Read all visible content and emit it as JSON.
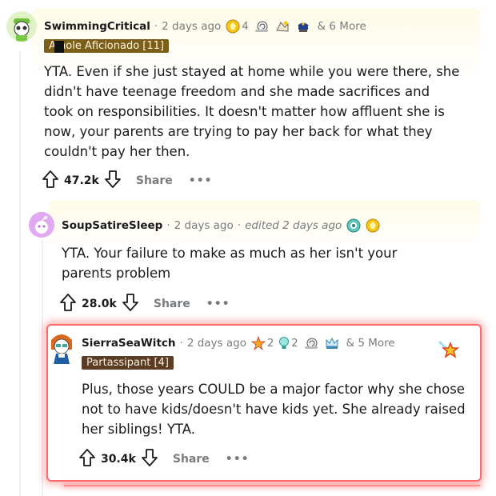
{
  "comments": [
    {
      "username": "SwimmingCritical",
      "timestamp": "2 days ago",
      "awards": [
        {
          "icon": "gold-helper-award-icon",
          "count": "4"
        },
        {
          "icon": "wholesome-snail-award-icon",
          "count": ""
        },
        {
          "icon": "take-my-energy-award-icon",
          "count": ""
        },
        {
          "icon": "police-cap-award-icon",
          "count": ""
        }
      ],
      "more_awards": "& 6 More",
      "flair": "A  hole Aficionado [11]",
      "body": "YTA. Even if she just stayed at home while you were there, she didn't have teenage freedom and she made sacrifices and took on responsibilities. It doesn't matter how affluent she is now, your parents are trying to pay her back for what they couldn't pay her then.",
      "score": "47.2k",
      "share": "Share",
      "more_options": "•••"
    },
    {
      "username": "SoupSatireSleep",
      "timestamp": "2 days ago",
      "edited": "edited 2 days ago",
      "awards": [
        {
          "icon": "blue-eye-award-icon",
          "count": ""
        },
        {
          "icon": "gold-helper-award-icon",
          "count": ""
        }
      ],
      "body": "YTA. Your failure to make as much as her isn't your parents problem",
      "score": "28.0k",
      "share": "Share",
      "more_options": "•••"
    },
    {
      "username": "SierraSeaWitch",
      "timestamp": "2 days ago",
      "awards": [
        {
          "icon": "starstruck-award-icon",
          "count": "2"
        },
        {
          "icon": "helpful-bulb-award-icon",
          "count": "2"
        },
        {
          "icon": "wholesome-snail-award-icon",
          "count": ""
        },
        {
          "icon": "crown-award-icon",
          "count": ""
        }
      ],
      "more_awards": "& 5 More",
      "flair": "Partassipant [4]",
      "body": "Plus, those years COULD be a major factor why she chose not to have kids/doesn't have kids yet. She already raised her siblings! YTA.",
      "score": "30.4k",
      "share": "Share",
      "more_options": "•••"
    }
  ],
  "colors": {
    "flair_bg_1": "#8a6b1e",
    "flair_bg_2": "#6b4a2e",
    "highlight_border": "#ff6b6b",
    "gold_highlight": "#fffbe6"
  }
}
